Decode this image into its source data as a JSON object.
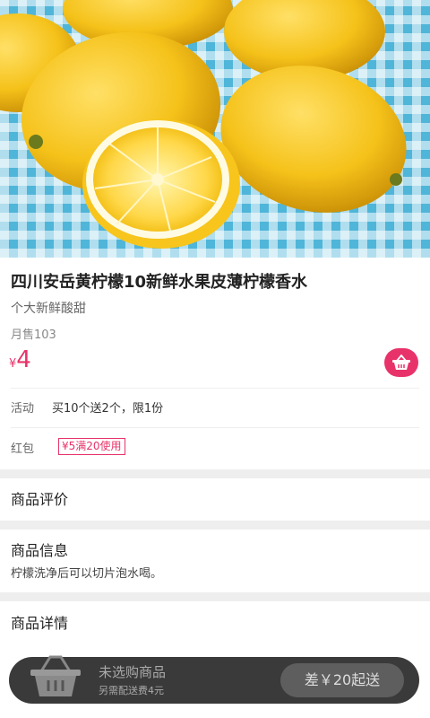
{
  "product": {
    "title": "四川安岳黄柠檬10新鲜水果皮薄柠檬香水",
    "subtitle": "个大新鲜酸甜",
    "monthly_sales": "月售103",
    "price_symbol": "¥",
    "price": "4"
  },
  "activity": {
    "label": "活动",
    "value": "买10个送2个，限1份"
  },
  "red_packet": {
    "label": "红包",
    "value": "¥5满20使用"
  },
  "sections": {
    "reviews_title": "商品评价",
    "info_title": "商品信息",
    "info_text": "柠檬洗净后可以切片泡水喝。",
    "details_title": "商品详情"
  },
  "cart_bar": {
    "status": "未选购商品",
    "delivery_fee": "另需配送费4元",
    "checkout_label": "差￥20起送"
  },
  "colors": {
    "accent": "#e8336a",
    "bar": "#3a3a3a"
  },
  "icons": [
    "lemon-photo",
    "basket-icon",
    "shopping-bag-icon"
  ]
}
